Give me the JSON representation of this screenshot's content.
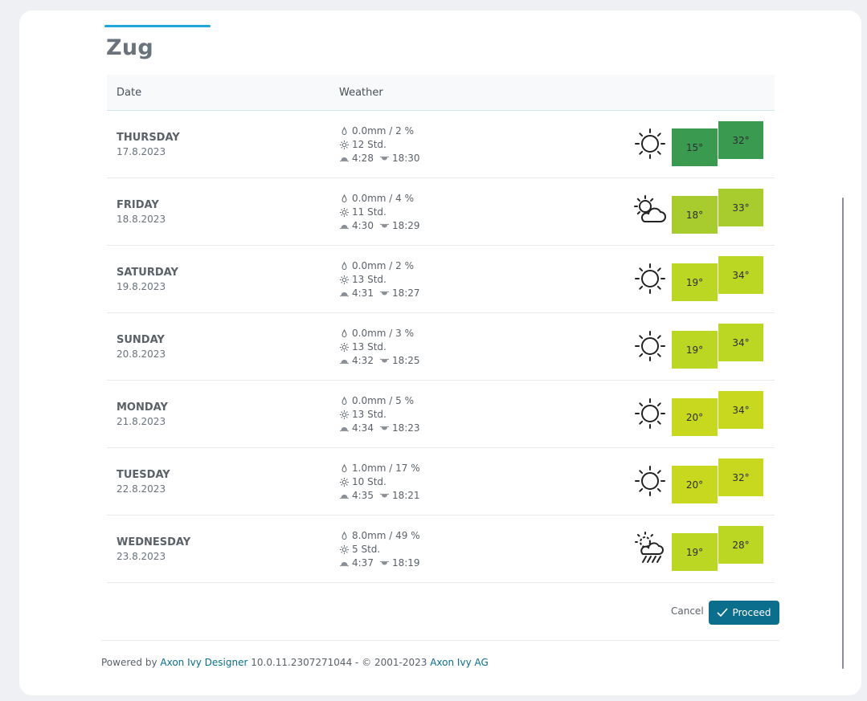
{
  "city": "Zug",
  "table": {
    "headers": {
      "date": "Date",
      "weather": "Weather"
    },
    "rows": [
      {
        "day": "THURSDAY",
        "date": "17.8.2023",
        "precip": "0.0mm / 2 %",
        "sun": "12 Std.",
        "sunrise": "4:28",
        "sunset": "18:30",
        "icon": "sun-icon",
        "min": "15°",
        "max": "32°",
        "min_color": "#3a9a4f",
        "max_color": "#3a9a4f"
      },
      {
        "day": "FRIDAY",
        "date": "18.8.2023",
        "precip": "0.0mm / 4 %",
        "sun": "11 Std.",
        "sunrise": "4:30",
        "sunset": "18:29",
        "icon": "sun-behind-cloud-icon",
        "min": "18°",
        "max": "33°",
        "min_color": "#a8cc2e",
        "max_color": "#a8cc2e"
      },
      {
        "day": "SATURDAY",
        "date": "19.8.2023",
        "precip": "0.0mm / 2 %",
        "sun": "13 Std.",
        "sunrise": "4:31",
        "sunset": "18:27",
        "icon": "sun-icon",
        "min": "19°",
        "max": "34°",
        "min_color": "#bcd624",
        "max_color": "#bcd624"
      },
      {
        "day": "SUNDAY",
        "date": "20.8.2023",
        "precip": "0.0mm / 3 %",
        "sun": "13 Std.",
        "sunrise": "4:32",
        "sunset": "18:25",
        "icon": "sun-icon",
        "min": "19°",
        "max": "34°",
        "min_color": "#bcd624",
        "max_color": "#bcd624"
      },
      {
        "day": "MONDAY",
        "date": "21.8.2023",
        "precip": "0.0mm / 5 %",
        "sun": "13 Std.",
        "sunrise": "4:34",
        "sunset": "18:23",
        "icon": "sun-icon",
        "min": "20°",
        "max": "34°",
        "min_color": "#c7d81f",
        "max_color": "#c7d81f"
      },
      {
        "day": "TUESDAY",
        "date": "22.8.2023",
        "precip": "1.0mm / 17 %",
        "sun": "10 Std.",
        "sunrise": "4:35",
        "sunset": "18:21",
        "icon": "sun-icon",
        "min": "20°",
        "max": "32°",
        "min_color": "#c7d81f",
        "max_color": "#c7d81f"
      },
      {
        "day": "WEDNESDAY",
        "date": "23.8.2023",
        "precip": "8.0mm / 49 %",
        "sun": "5 Std.",
        "sunrise": "4:37",
        "sunset": "18:19",
        "icon": "sun-cloud-rain-icon",
        "min": "19°",
        "max": "28°",
        "min_color": "#bcd624",
        "max_color": "#bcd624"
      }
    ]
  },
  "actions": {
    "cancel": "Cancel",
    "proceed": "Proceed"
  },
  "footer": {
    "prefix": "Powered by",
    "designer_link": "Axon Ivy Designer",
    "version": "10.0.11.2307271044 - © 2001-2023",
    "company_link": "Axon Ivy AG"
  },
  "colors": {
    "accent": "#1ea7d8",
    "primary_button": "#0a6e8c"
  }
}
